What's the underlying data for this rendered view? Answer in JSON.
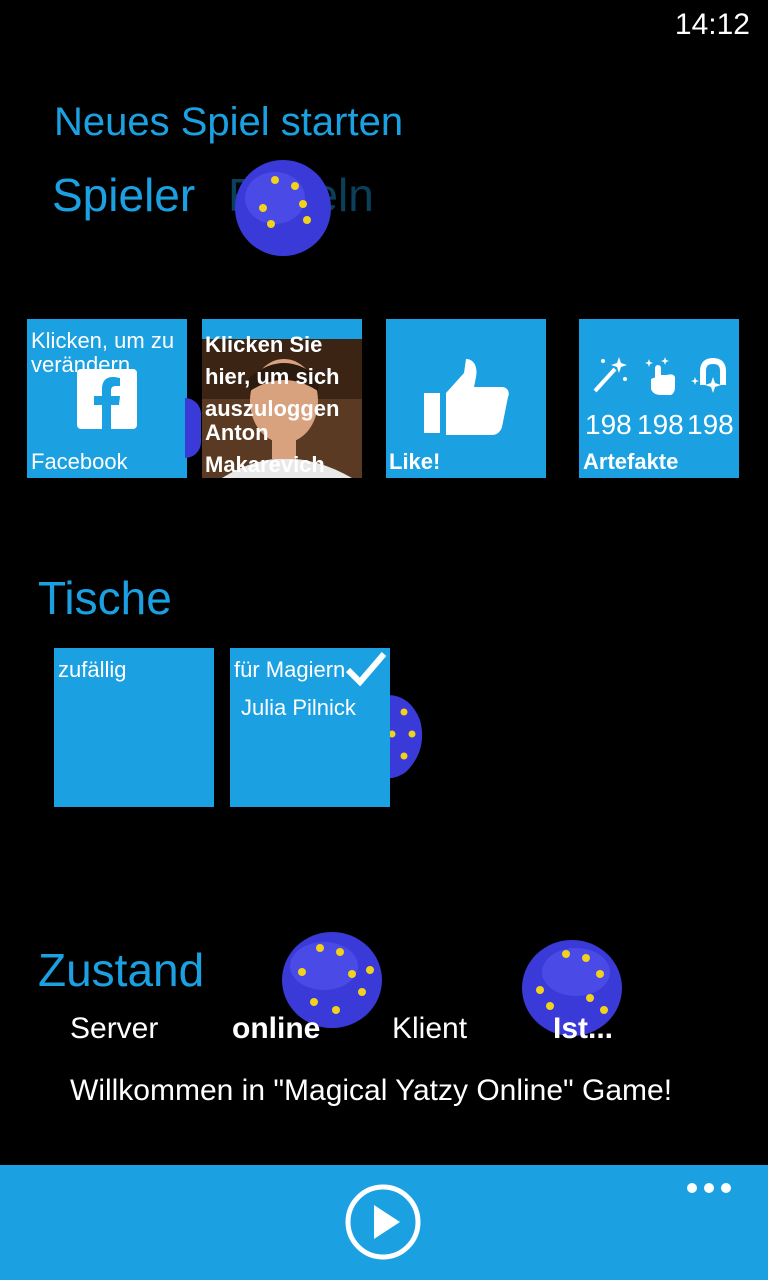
{
  "status": {
    "time": "14:12"
  },
  "header": {
    "title": "Neues Spiel starten",
    "pivots": [
      "Spieler",
      "Regeln"
    ]
  },
  "tiles": {
    "facebook": {
      "top": "Klicken, um zu verändern",
      "bottom": "Facebook"
    },
    "account": {
      "text": "Klicken Sie hier, um sich auszuloggen",
      "name": "Anton Makarevich"
    },
    "like": {
      "label": "Like!"
    },
    "artifacts": {
      "counts": [
        "198",
        "198",
        "198"
      ],
      "label": "Artefakte"
    }
  },
  "tables": {
    "title": "Tische",
    "items": [
      {
        "label": "zufällig"
      },
      {
        "label": "für Magiern",
        "player": "Julia Pilnick",
        "checked": true
      }
    ]
  },
  "state": {
    "title": "Zustand",
    "server_label": "Server",
    "server_value": "online",
    "client_label": "Klient",
    "client_value": "Ist...",
    "welcome": "Willkommen in \"Magical Yatzy Online\" Game!"
  },
  "colors": {
    "accent": "#1ba1e2",
    "background": "#000000",
    "dice": "#3a3ad8",
    "pips": "#f2d21b"
  },
  "icons": [
    "facebook-icon",
    "thumbs-up-icon",
    "magic-wand-icon",
    "tap-icon",
    "magnet-icon",
    "checkmark-icon",
    "play-icon",
    "more-icon",
    "dice-icon"
  ]
}
